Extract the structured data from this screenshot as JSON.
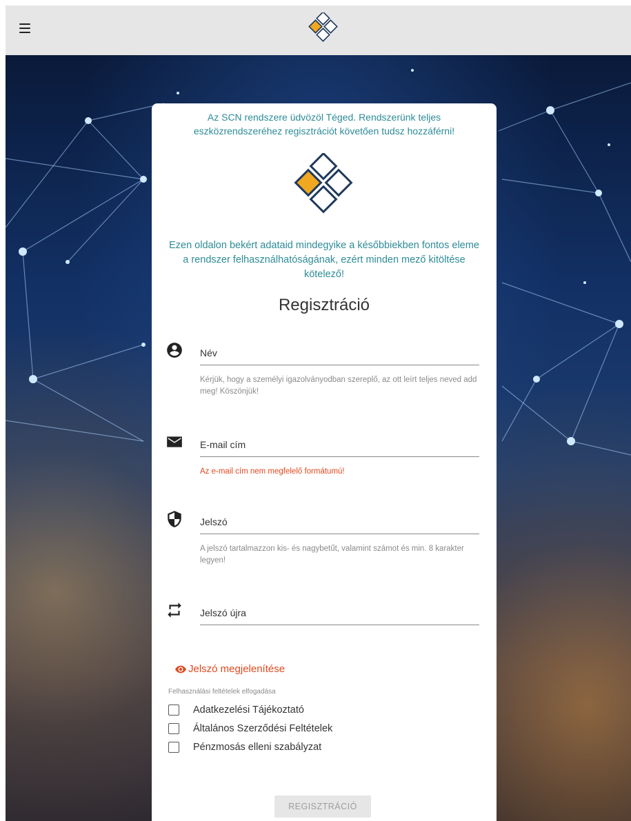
{
  "header": {
    "menu_icon": "hamburger-icon",
    "logo_icon": "scn-diamond-logo"
  },
  "card": {
    "intro_text": "Az SCN rendszere üdvözöl Téged. Rendszerünk teljes eszközrendszeréhez regisztrációt követően tudsz hozzáférni!",
    "info_text": "Ezen oldalon bekért adataid mindegyike a későbbiekben fontos eleme a rendszer felhasználhatóságának, ezért minden mező kitöltése kötelező!",
    "title": "Regisztráció"
  },
  "fields": {
    "name": {
      "placeholder": "Név",
      "value": "",
      "icon": "account-circle-icon",
      "hint": "Kérjük, hogy a személyi igazolványodban szereplő, az ott leírt teljes neved add meg! Köszönjük!"
    },
    "email": {
      "placeholder": "E-mail cím",
      "value": "",
      "icon": "mail-icon",
      "error": "Az e-mail cím nem megfelelő formátumú!"
    },
    "password": {
      "placeholder": "Jelszó",
      "value": "",
      "icon": "shield-icon",
      "hint": "A jelszó tartalmazzon kis- és nagybetűt, valamint számot és min. 8 karakter legyen!"
    },
    "password_repeat": {
      "placeholder": "Jelszó újra",
      "value": "",
      "icon": "repeat-icon"
    }
  },
  "show_password": {
    "label": "Jelszó megjelenítése",
    "icon": "eye-icon"
  },
  "terms": {
    "heading": "Felhasználási feltételek elfogadása",
    "items": [
      {
        "label": "Adatkezelési Tájékoztató",
        "checked": false
      },
      {
        "label": "Általános Szerződési Feltételek",
        "checked": false
      },
      {
        "label": "Pénzmosás elleni szabályzat",
        "checked": false
      }
    ]
  },
  "submit": {
    "label": "REGISZTRÁCIÓ",
    "disabled": true
  },
  "colors": {
    "accent_teal": "#2d8b97",
    "logo_navy": "#1f3a5c",
    "logo_orange": "#f0a820",
    "error_red": "#e0491f",
    "topbar_gray": "#e6e6e6"
  }
}
